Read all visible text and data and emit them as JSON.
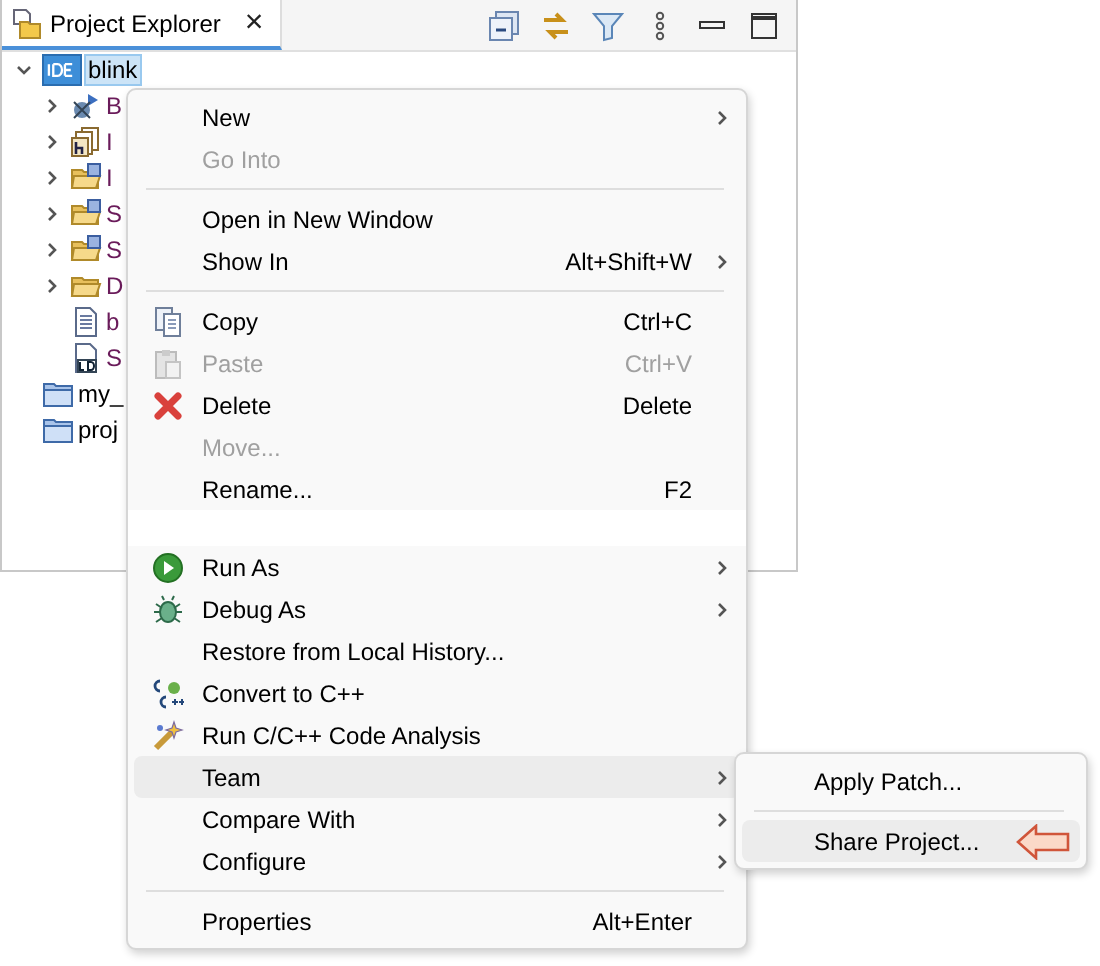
{
  "view": {
    "tab": {
      "label": "Project Explorer",
      "close": "×",
      "selected": true
    }
  },
  "tree": [
    {
      "label": "blink",
      "selected": true,
      "expanded": true,
      "children": [
        {
          "label": "B",
          "expanded": false
        },
        {
          "label": "I",
          "expanded": false
        },
        {
          "label": "I",
          "expanded": false
        },
        {
          "label": "S",
          "expanded": false
        },
        {
          "label": "S",
          "expanded": false
        },
        {
          "label": "D",
          "expanded": false
        },
        {
          "label": "b"
        },
        {
          "label": "S"
        }
      ]
    },
    {
      "label": "my_",
      "selected": false
    },
    {
      "label": "proj",
      "selected": false
    }
  ],
  "context_menu": [
    {
      "kind": "item",
      "label": "New",
      "submenu": true,
      "disabled": false,
      "selected": false
    },
    {
      "kind": "item",
      "label": "Go Into",
      "disabled": true,
      "selected": false
    },
    {
      "kind": "separator"
    },
    {
      "kind": "item",
      "label": "Open in New Window",
      "disabled": false,
      "selected": false
    },
    {
      "kind": "item",
      "label": "Show In",
      "shortcut": "Alt+Shift+W",
      "submenu": true,
      "disabled": false,
      "selected": false
    },
    {
      "kind": "separator"
    },
    {
      "kind": "item",
      "label": "Copy",
      "shortcut": "Ctrl+C",
      "disabled": false,
      "selected": false
    },
    {
      "kind": "item",
      "label": "Paste",
      "shortcut": "Ctrl+V",
      "disabled": true,
      "selected": false
    },
    {
      "kind": "item",
      "label": "Delete",
      "shortcut": "Delete",
      "disabled": false,
      "selected": false
    },
    {
      "kind": "item",
      "label": "Move...",
      "disabled": true,
      "selected": false
    },
    {
      "kind": "item",
      "label": "Rename...",
      "shortcut": "F2",
      "disabled": false,
      "selected": false
    },
    {
      "kind": "gap"
    },
    {
      "kind": "item",
      "label": "Run As",
      "submenu": true,
      "disabled": false,
      "selected": false
    },
    {
      "kind": "item",
      "label": "Debug As",
      "submenu": true,
      "disabled": false,
      "selected": false
    },
    {
      "kind": "item",
      "label": "Restore from Local History...",
      "disabled": false,
      "selected": false
    },
    {
      "kind": "item",
      "label": "Convert to C++",
      "disabled": false,
      "selected": false
    },
    {
      "kind": "item",
      "label": "Run C/C++ Code Analysis",
      "disabled": false,
      "selected": false
    },
    {
      "kind": "item",
      "label": "Team",
      "submenu": true,
      "disabled": false,
      "selected": true
    },
    {
      "kind": "item",
      "label": "Compare With",
      "submenu": true,
      "disabled": false,
      "selected": false
    },
    {
      "kind": "item",
      "label": "Configure",
      "submenu": true,
      "disabled": false,
      "selected": false
    },
    {
      "kind": "separator"
    },
    {
      "kind": "item",
      "label": "Properties",
      "shortcut": "Alt+Enter",
      "disabled": false,
      "selected": false
    }
  ],
  "team_submenu": [
    {
      "kind": "item",
      "label": "Apply Patch...",
      "disabled": false,
      "selected": false
    },
    {
      "kind": "separator"
    },
    {
      "kind": "item",
      "label": "Share Project...",
      "disabled": false,
      "selected": true,
      "pointer_arrow": true
    }
  ]
}
